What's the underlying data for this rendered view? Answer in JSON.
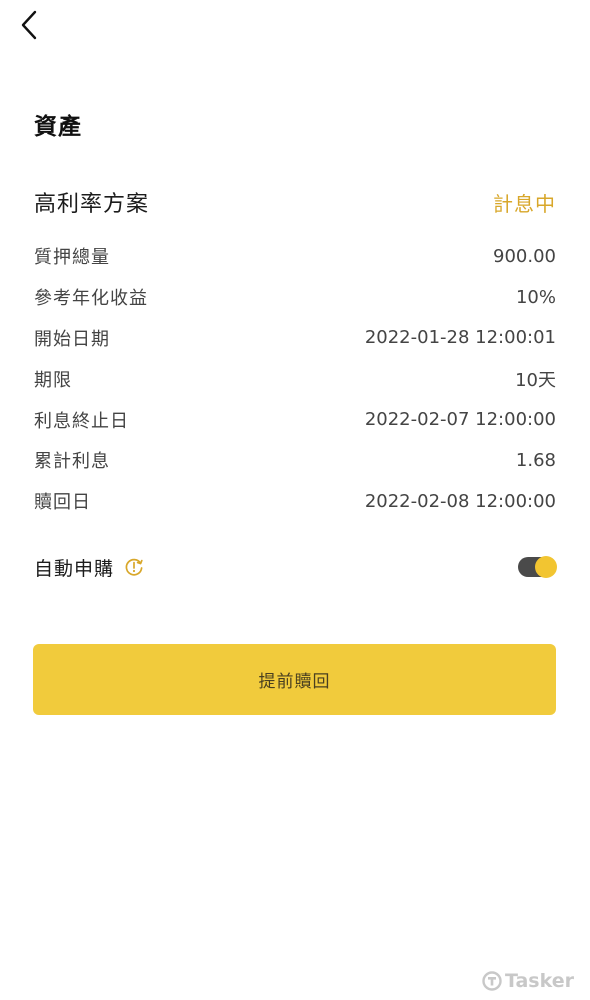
{
  "header": {
    "back_icon": "chevron-left-icon"
  },
  "section_title": "資產",
  "plan": {
    "name": "高利率方案",
    "status": "計息中",
    "status_color": "#d8a72a"
  },
  "details": [
    {
      "label": "質押總量",
      "value": "900.00"
    },
    {
      "label": "參考年化收益",
      "value": "10%"
    },
    {
      "label": "開始日期",
      "value": "2022-01-28 12:00:01"
    },
    {
      "label": "期限",
      "value": "10天"
    },
    {
      "label": "利息終止日",
      "value": "2022-02-07 12:00:00"
    },
    {
      "label": "累計利息",
      "value": "1.68"
    },
    {
      "label": "贖回日",
      "value": "2022-02-08 12:00:00"
    }
  ],
  "auto_subscribe": {
    "label": "自動申購",
    "info_icon": "clock-info-icon",
    "enabled": true,
    "toggle_track_color": "#4a4a4a",
    "toggle_knob_color": "#f2c531"
  },
  "redeem_button": {
    "label": "提前贖回",
    "color": "#f1cb3c"
  },
  "watermark": {
    "text": "Tasker",
    "icon": "tasker-logo-icon"
  }
}
